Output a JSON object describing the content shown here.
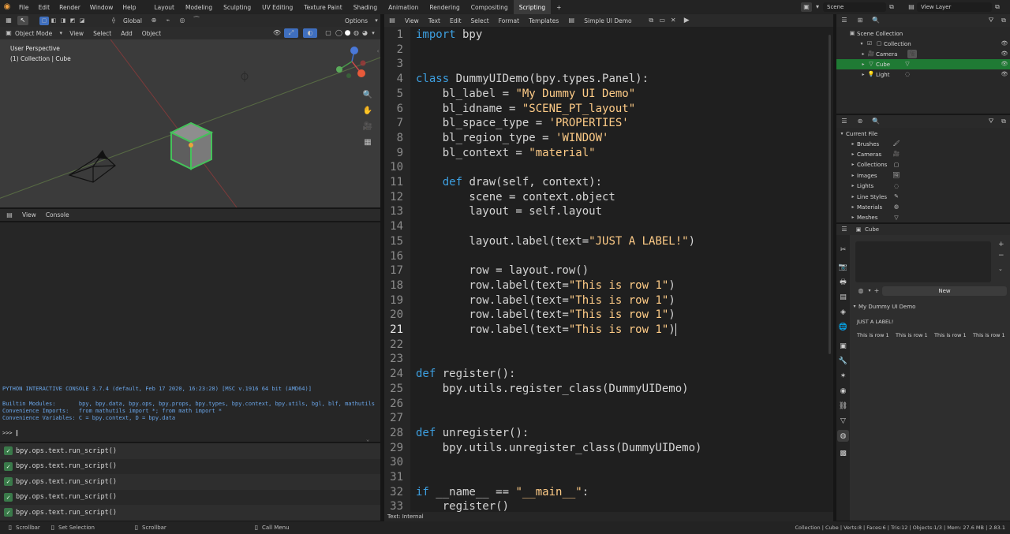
{
  "menu": [
    "File",
    "Edit",
    "Render",
    "Window",
    "Help"
  ],
  "workspaces": [
    "Layout",
    "Modeling",
    "Sculpting",
    "UV Editing",
    "Texture Paint",
    "Shading",
    "Animation",
    "Rendering",
    "Compositing",
    "Scripting"
  ],
  "active_workspace": "Scripting",
  "add_tab": "+",
  "scene_name": "Scene",
  "view_layer": "View Layer",
  "viewport": {
    "transform_orientation": "Global",
    "options_label": "Options",
    "mode": "Object Mode",
    "menus": [
      "View",
      "Select",
      "Add",
      "Object"
    ],
    "perspective": "User Perspective",
    "collection_info": "(1) Collection | Cube"
  },
  "console_header": {
    "menus": [
      "View",
      "Console"
    ]
  },
  "console": {
    "banner": "PYTHON INTERACTIVE CONSOLE 3.7.4 (default, Feb 17 2020, 16:23:28) [MSC v.1916 64 bit (AMD64)]",
    "builtin_modules": "Builtin Modules:       bpy, bpy.data, bpy.ops, bpy.props, bpy.types, bpy.context, bpy.utils, bgl, blf, mathutils",
    "convenience_imports": "Convenience Imports:   from mathutils import *; from math import *",
    "convenience_vars": "Convenience Variables: C = bpy.context, D = bpy.data",
    "prompt": ">>> "
  },
  "info_log": [
    "bpy.ops.text.run_script()",
    "bpy.ops.text.run_script()",
    "bpy.ops.text.run_script()",
    "bpy.ops.text.run_script()",
    "bpy.ops.text.run_script()"
  ],
  "text_editor": {
    "menus": [
      "View",
      "Text",
      "Edit",
      "Select",
      "Format",
      "Templates"
    ],
    "file_name": "Simple UI Demo",
    "footer": "Text: Internal",
    "current_line": 21
  },
  "code_lines": [
    {
      "n": "1",
      "t": "import bpy"
    },
    {
      "n": "2",
      "t": ""
    },
    {
      "n": "3",
      "t": ""
    },
    {
      "n": "4",
      "t": "class DummyUIDemo(bpy.types.Panel):"
    },
    {
      "n": "5",
      "t": "    bl_label = \"My Dummy UI Demo\""
    },
    {
      "n": "6",
      "t": "    bl_idname = \"SCENE_PT_layout\""
    },
    {
      "n": "7",
      "t": "    bl_space_type = 'PROPERTIES'"
    },
    {
      "n": "8",
      "t": "    bl_region_type = 'WINDOW'"
    },
    {
      "n": "9",
      "t": "    bl_context = \"material\""
    },
    {
      "n": "10",
      "t": ""
    },
    {
      "n": "11",
      "t": "    def draw(self, context):"
    },
    {
      "n": "12",
      "t": "        scene = context.object"
    },
    {
      "n": "13",
      "t": "        layout = self.layout"
    },
    {
      "n": "14",
      "t": ""
    },
    {
      "n": "15",
      "t": "        layout.label(text=\"JUST A LABEL!\")"
    },
    {
      "n": "16",
      "t": ""
    },
    {
      "n": "17",
      "t": "        row = layout.row()"
    },
    {
      "n": "18",
      "t": "        row.label(text=\"This is row 1\")"
    },
    {
      "n": "19",
      "t": "        row.label(text=\"This is row 1\")"
    },
    {
      "n": "20",
      "t": "        row.label(text=\"This is row 1\")"
    },
    {
      "n": "21",
      "t": "        row.label(text=\"This is row 1\")"
    },
    {
      "n": "22",
      "t": ""
    },
    {
      "n": "23",
      "t": ""
    },
    {
      "n": "24",
      "t": "def register():"
    },
    {
      "n": "25",
      "t": "    bpy.utils.register_class(DummyUIDemo)"
    },
    {
      "n": "26",
      "t": ""
    },
    {
      "n": "27",
      "t": ""
    },
    {
      "n": "28",
      "t": "def unregister():"
    },
    {
      "n": "29",
      "t": "    bpy.utils.unregister_class(DummyUIDemo)"
    },
    {
      "n": "30",
      "t": ""
    },
    {
      "n": "31",
      "t": ""
    },
    {
      "n": "32",
      "t": "if __name__ == \"__main__\":"
    },
    {
      "n": "33",
      "t": "    register()"
    }
  ],
  "outliner": {
    "root": "Scene Collection",
    "items": [
      {
        "label": "Collection",
        "indent": 1,
        "selected": false
      },
      {
        "label": "Camera",
        "indent": 2,
        "selected": false
      },
      {
        "label": "Cube",
        "indent": 2,
        "selected": true
      },
      {
        "label": "Light",
        "indent": 2,
        "selected": false
      }
    ]
  },
  "file_browser": {
    "root": "Current File",
    "items": [
      "Brushes",
      "Cameras",
      "Collections",
      "Images",
      "Lights",
      "Line Styles",
      "Materials",
      "Meshes"
    ]
  },
  "properties": {
    "object_name": "Cube",
    "new_button": "New",
    "panel_title": "My Dummy UI Demo",
    "label": "JUST A LABEL!",
    "row_labels": [
      "This is row 1",
      "This is row 1",
      "This is row 1",
      "This is row 1"
    ]
  },
  "status_bar": {
    "left": [
      "Scrollbar",
      "Set Selection",
      "Scrollbar",
      "Call Menu"
    ],
    "stats": "Collection | Cube | Verts:8 | Faces:6 | Tris:12 | Objects:1/3 | Mem: 27.6 MB | 2.83.1"
  },
  "colors": {
    "accent_blue": "#3d9fe0",
    "string": "#ffcc87",
    "selection_green": "#1f7a34",
    "active_orange": "#e8a33d"
  }
}
